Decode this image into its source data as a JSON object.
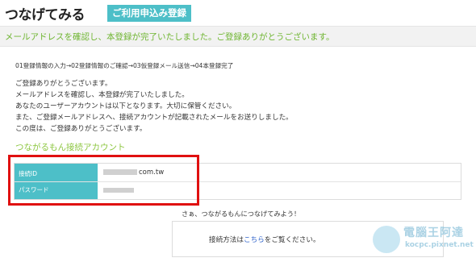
{
  "header": {
    "site_title": "つなげてみる",
    "badge_label": "ご利用申込み登録"
  },
  "banner": {
    "message": "メールアドレスを確認し、本登録が完了いたしました。ご登録ありがとうございます。"
  },
  "steps": "01登録情報の入力→02登録情報のご確認→03仮登録メール送信→04本登録完了",
  "messages": [
    "ご登録ありがとうございます。",
    "メールアドレスを確認し、本登録が完了いたしました。",
    "あなたのユーザーアカウントは以下となります。大切に保管ください。",
    "また、ご登録メールアドレスへ、接続アカウントが記載されたメールをお送りしました。",
    "この度は、ご登録ありがとうございます。"
  ],
  "account": {
    "section_title": "つながるもん接続アカウント",
    "id_label": "接続ID",
    "id_value_suffix": "com.tw",
    "password_label": "パスワード"
  },
  "cta": "さぁ、つながるもんにつなげてみよう！",
  "howto": {
    "prefix": "接続方法は",
    "link_text": "こちら",
    "suffix": "をご覧ください。"
  },
  "watermark": {
    "title": "電腦王阿達",
    "url": "kocpc.pixnet.net"
  },
  "colors": {
    "accent_teal": "#4dbfc8",
    "accent_green": "#6fb531",
    "highlight_red": "#e01010",
    "link_blue": "#3366cc"
  }
}
